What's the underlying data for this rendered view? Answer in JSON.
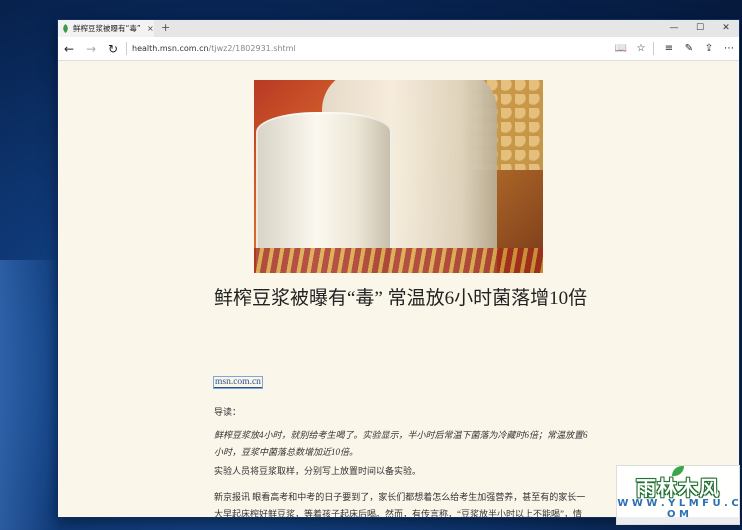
{
  "browser": {
    "tab": {
      "title": "鲜榨豆浆被曝有“毒” 常",
      "close": "×"
    },
    "new_tab": "+",
    "window_controls": {
      "minimize": "—",
      "maximize": "☐",
      "close": "✕"
    },
    "nav": {
      "back": "←",
      "forward": "→",
      "refresh": "↻"
    },
    "url": {
      "host": "health.msn.com.cn",
      "path": "/tjwz2/1802931.shtml"
    },
    "tools": {
      "reading_view": "📖",
      "favorite": "☆",
      "hub": "≡",
      "note": "✎",
      "share": "⇪",
      "more": "⋯"
    }
  },
  "article": {
    "headline": "鲜榨豆浆被曝有“毒” 常温放6小时菌落增10倍",
    "source": "msn.com.cn",
    "paragraphs": {
      "p1": "导读：",
      "p2": "鲜榨豆浆放4小时，就别给考生喝了。实验显示，半小时后常温下菌落为冷藏时6倍；常温放置6小时，豆浆中菌落总数增加近10倍。",
      "p3": "实验人员将豆浆取样，分别写上放置时间以备实验。",
      "p4": "新京报讯 眼看高考和中考的日子要到了，家长们都想着怎么给考生加强营养，甚至有的家长一大早起床榨好鲜豆浆，等着孩子起床后喝。然而，有传言称，“豆浆放半小时以上不能喝”，情况到底怎样？"
    }
  },
  "watermark": {
    "main": "雨林木风",
    "sub": "W W W . Y L M F U . C O M"
  }
}
